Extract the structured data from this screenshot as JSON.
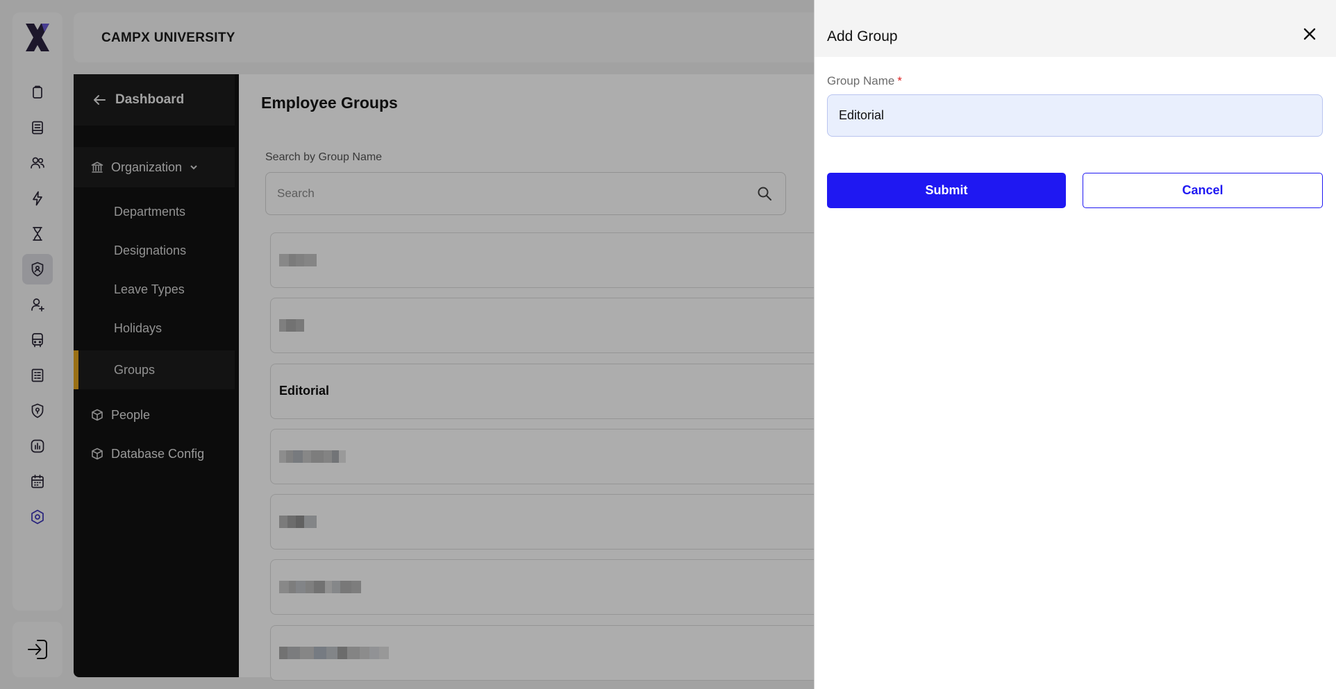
{
  "app": {
    "title": "CAMPX UNIVERSITY"
  },
  "rail": {
    "logo_icon": "campx-x-logo",
    "items": [
      {
        "icon": "clipboard-icon"
      },
      {
        "icon": "notebook-icon"
      },
      {
        "icon": "users-icon"
      },
      {
        "icon": "lightning-icon"
      },
      {
        "icon": "hourglass-icon"
      },
      {
        "icon": "shield-user-icon",
        "active": true
      },
      {
        "icon": "user-add-icon"
      },
      {
        "icon": "bus-icon"
      },
      {
        "icon": "ledger-icon"
      },
      {
        "icon": "shield-pin-icon"
      },
      {
        "icon": "bar-chart-icon"
      },
      {
        "icon": "calendar-icon"
      },
      {
        "icon": "hexagon-settings-icon"
      }
    ],
    "logout_icon": "logout-icon"
  },
  "sidenav": {
    "back_label": "Dashboard",
    "organization_label": "Organization",
    "sub_items": [
      "Departments",
      "Designations",
      "Leave Types",
      "Holidays",
      "Groups"
    ],
    "active_sub": "Groups",
    "people_label": "People",
    "database_label": "Database Config",
    "accent_color": "#e3a51f"
  },
  "main": {
    "page_title": "Employee Groups",
    "search_label": "Search by Group Name",
    "search_placeholder": "Search",
    "groups": [
      {
        "name": "",
        "redacted": true
      },
      {
        "name": "",
        "redacted": true
      },
      {
        "name": "Editorial",
        "redacted": false
      },
      {
        "name": "",
        "redacted": true
      },
      {
        "name": "",
        "redacted": true
      },
      {
        "name": "",
        "redacted": true
      },
      {
        "name": "",
        "redacted": true
      }
    ]
  },
  "drawer": {
    "title": "Add Group",
    "field_label": "Group Name",
    "required_mark": "*",
    "field_value": "Editorial",
    "submit_label": "Submit",
    "cancel_label": "Cancel",
    "primary_color": "#1f18f2"
  }
}
